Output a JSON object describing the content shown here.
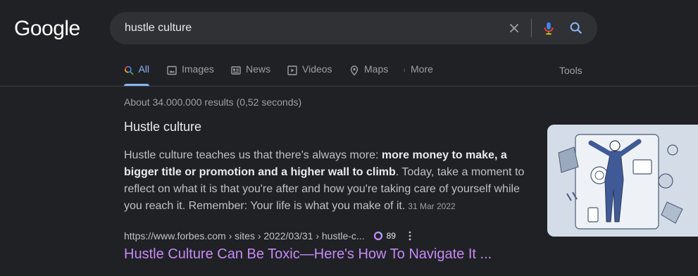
{
  "logo": "Google",
  "search": {
    "query": "hustle culture"
  },
  "tabs": [
    {
      "label": "All",
      "icon": "search-multicolor-icon"
    },
    {
      "label": "Images",
      "icon": "image-icon"
    },
    {
      "label": "News",
      "icon": "news-icon"
    },
    {
      "label": "Videos",
      "icon": "video-icon"
    },
    {
      "label": "Maps",
      "icon": "map-pin-icon"
    },
    {
      "label": "More",
      "icon": "more-vert-icon"
    }
  ],
  "tools_label": "Tools",
  "stats": "About 34.000.000 results (0,52 seconds)",
  "featured": {
    "heading": "Hustle culture",
    "text_1": "Hustle culture teaches us that there's always more: ",
    "bold": "more money to make, a bigger title or promotion and a higher wall to climb",
    "text_2": ". Today, take a moment to reflect on what it is that you're after and how you're taking care of yourself while you reach it. Remember: Your life is what you make of it.",
    "date": "31 Mar 2022"
  },
  "result": {
    "url": "https://www.forbes.com › sites › 2022/03/31 › hustle-c...",
    "count": "89",
    "title": "Hustle Culture Can Be Toxic—Here's How To Navigate It ..."
  },
  "colors": {
    "background": "#202124",
    "link": "#c58af9",
    "accent": "#8ab4f8"
  }
}
